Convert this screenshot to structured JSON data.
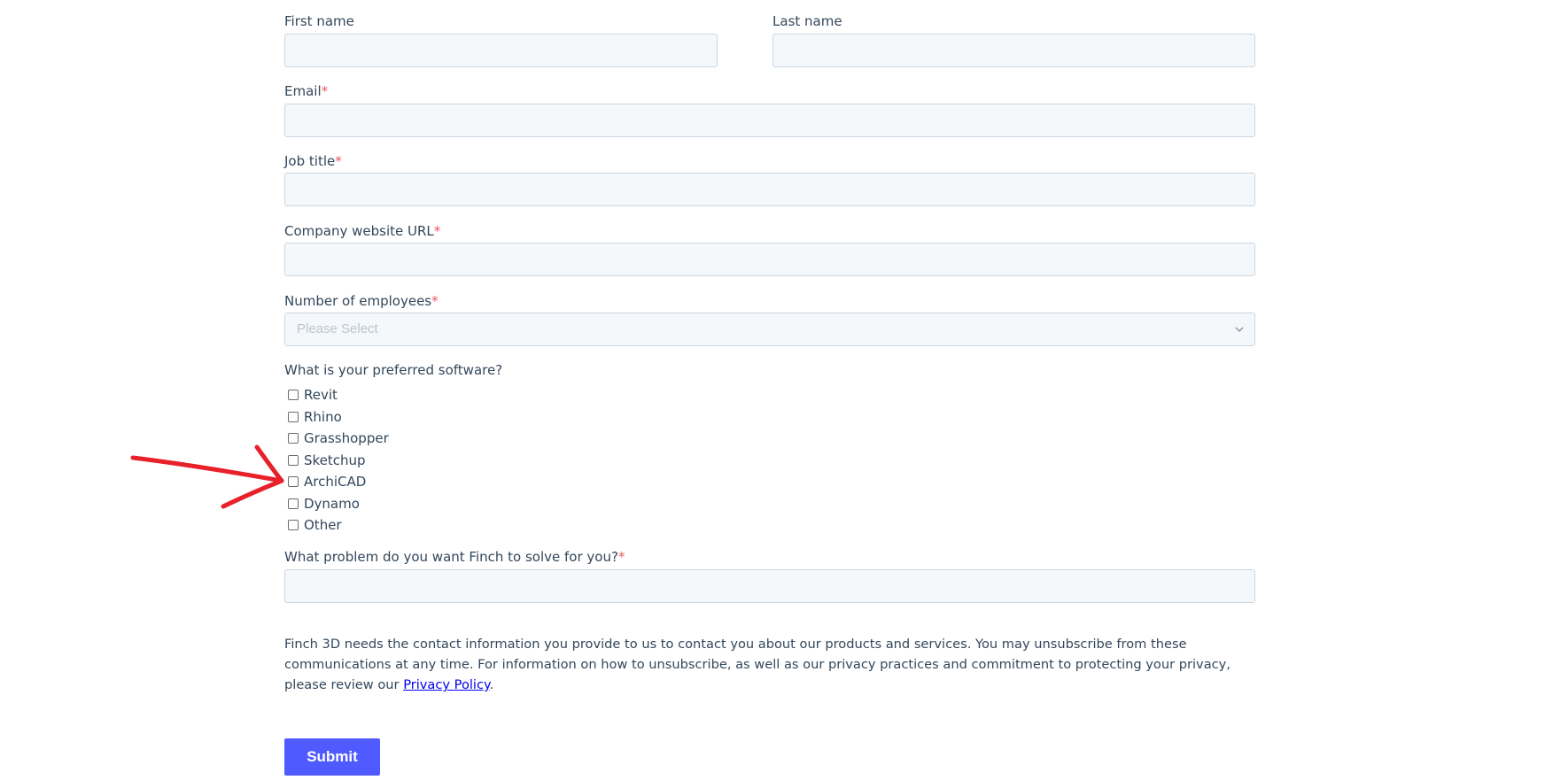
{
  "form": {
    "first_name_label": "First name",
    "last_name_label": "Last name",
    "email_label": "Email",
    "job_title_label": "Job title",
    "company_url_label": "Company website URL",
    "employees_label": "Number of employees",
    "employees_placeholder": "Please Select",
    "software_question": "What is your preferred software?",
    "software_options": [
      "Revit",
      "Rhino",
      "Grasshopper",
      "Sketchup",
      "ArchiCAD",
      "Dynamo",
      "Other"
    ],
    "problem_label": "What problem do you want Finch to solve for you?",
    "required_marker": "*"
  },
  "legal": {
    "text_before_link": "Finch 3D needs the contact information you provide to us to contact you about our products and services. You may unsubscribe from these communications at any time. For information on how to unsubscribe, as well as our privacy practices and commitment to protecting your privacy, please review our ",
    "link_text": "Privacy Policy",
    "text_after_link": "."
  },
  "submit_label": "Submit",
  "colors": {
    "accent": "#4f5bff",
    "required": "#f2545b",
    "annotation_arrow": "#e8202a"
  }
}
